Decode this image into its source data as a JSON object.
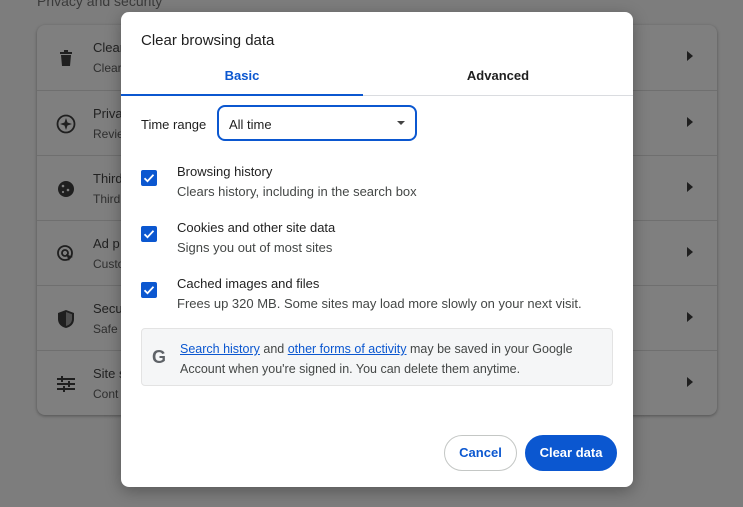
{
  "background": {
    "section_title": "Privacy and security",
    "rows": [
      {
        "icon": "trash-icon",
        "title": "Clear",
        "subtitle": "Clear"
      },
      {
        "icon": "privacy-guide-icon",
        "title": "Priva",
        "subtitle": "Revie"
      },
      {
        "icon": "cookie-icon",
        "title": "Third",
        "subtitle": "Third"
      },
      {
        "icon": "ad-privacy-icon",
        "title": "Ad p",
        "subtitle": "Custo"
      },
      {
        "icon": "shield-icon",
        "title": "Secu",
        "subtitle": "Safe"
      },
      {
        "icon": "tune-icon",
        "title": "Site s",
        "subtitle": "Cont"
      }
    ]
  },
  "dialog": {
    "title": "Clear browsing data",
    "tabs": [
      {
        "label": "Basic",
        "selected": true
      },
      {
        "label": "Advanced",
        "selected": false
      }
    ],
    "time_range": {
      "label": "Time range",
      "value": "All time"
    },
    "options": [
      {
        "title": "Browsing history",
        "description": "Clears history, including in the search box",
        "checked": true
      },
      {
        "title": "Cookies and other site data",
        "description": "Signs you out of most sites",
        "checked": true
      },
      {
        "title": "Cached images and files",
        "description": "Frees up 320 MB. Some sites may load more slowly on your next visit.",
        "checked": true
      }
    ],
    "info": {
      "link1": "Search history",
      "and": " and ",
      "link2": "other forms of activity",
      "rest": " may be saved in your Google Account when you're signed in. You can delete them anytime."
    },
    "buttons": {
      "cancel": "Cancel",
      "clear": "Clear data"
    }
  },
  "colors": {
    "accent": "#0b57d0",
    "overlay": "#7d7d7d"
  }
}
